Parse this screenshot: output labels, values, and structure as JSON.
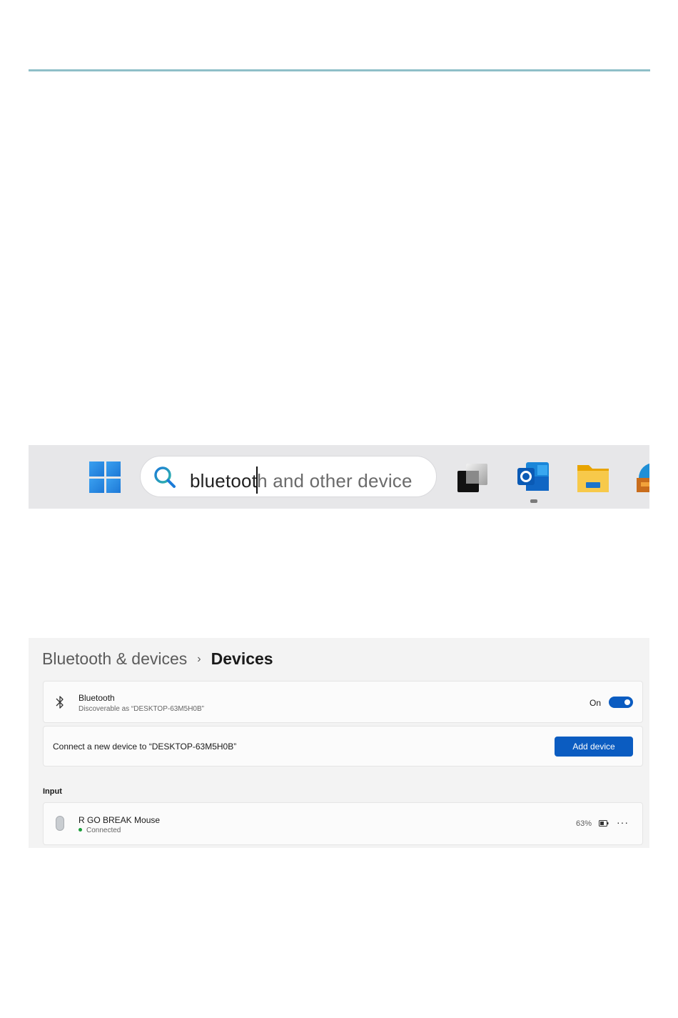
{
  "taskbar": {
    "search_typed": "bluetoot",
    "search_suggest": "h and other device",
    "apps": [
      "windows-start",
      "terminal",
      "outlook",
      "file-explorer",
      "edge"
    ]
  },
  "settings": {
    "breadcrumb_parent": "Bluetooth & devices",
    "breadcrumb_separator": "›",
    "breadcrumb_current": "Devices",
    "bluetooth_title": "Bluetooth",
    "bluetooth_subtitle": "Discoverable as “DESKTOP-63M5H0B”",
    "bluetooth_state": "On",
    "connect_text": "Connect a new device to “DESKTOP-63M5H0B”",
    "add_device_label": "Add device",
    "input_section": "Input",
    "device_name": "R GO BREAK Mouse",
    "device_status": "Connected",
    "battery": "63%",
    "more": "···"
  },
  "colors": {
    "accent": "#0b5cc1",
    "rule": "#8fbfc8",
    "connected": "#1a9e3a"
  }
}
